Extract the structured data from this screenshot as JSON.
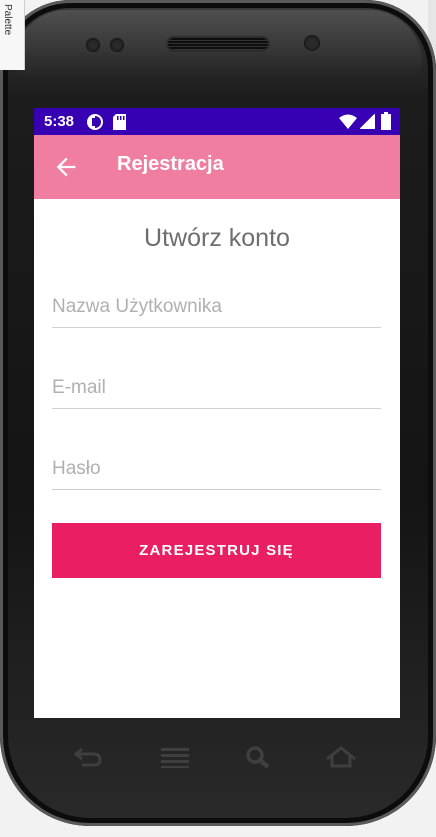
{
  "ide": {
    "palette_label": "Palette"
  },
  "status_bar": {
    "time": "5:38",
    "icons_left": [
      "notification-circle-icon",
      "sd-card-icon"
    ],
    "icons_right": [
      "wifi-icon",
      "signal-icon",
      "battery-icon"
    ],
    "color": "#3700b3"
  },
  "app_bar": {
    "title": "Rejestracja",
    "back_icon": "back-arrow-icon",
    "color": "#f07ea1"
  },
  "form": {
    "heading": "Utwórz konto",
    "username": {
      "value": "",
      "placeholder": "Nazwa Użytkownika"
    },
    "email": {
      "value": "",
      "placeholder": "E-mail"
    },
    "password": {
      "value": "",
      "placeholder": "Hasło"
    },
    "submit_label": "ZAREJESTRUJ SIĘ",
    "submit_color": "#e91e63"
  },
  "nav_bar": [
    "back-icon",
    "menu-icon",
    "search-icon",
    "home-icon"
  ]
}
